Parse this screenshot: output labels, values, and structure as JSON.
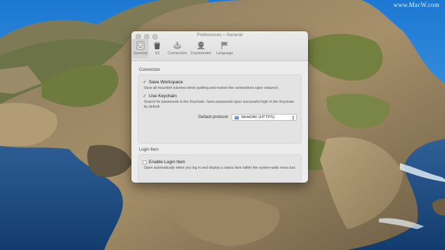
{
  "watermark": "www.MacW.com",
  "window": {
    "title": "Preferences – General",
    "tabs": [
      {
        "label": "General",
        "icon": "general-icon",
        "active": true
      },
      {
        "label": "S3",
        "icon": "s3-icon",
        "active": false
      },
      {
        "label": "Connection",
        "icon": "connection-icon",
        "active": false
      },
      {
        "label": "Cryptomator",
        "icon": "cryptomator-icon",
        "active": false
      },
      {
        "label": "Language",
        "icon": "language-icon",
        "active": false
      }
    ]
  },
  "connection": {
    "heading": "Connection",
    "save_workspace": {
      "label": "Save Workspace",
      "checked": true,
      "description": "Save all mounted volumes when quitting and restore the connections upon relaunch."
    },
    "use_keychain": {
      "label": "Use Keychain",
      "checked": true,
      "description": "Search for passwords in the Keychain. Save passwords upon successful login in the Keychain by default."
    },
    "default_protocol": {
      "label": "Default protocol:",
      "value": "WebDAV (HTTPS)"
    }
  },
  "login_item": {
    "heading": "Login Item",
    "enable": {
      "label": "Enable Login Item",
      "checked": false,
      "description": "Open automatically when you log in and display a status item within the system-wide menu bar."
    }
  },
  "colors": {
    "sky": "#1f7fd6",
    "sea": "#1f4f8a",
    "window_bg": "#ececec"
  }
}
